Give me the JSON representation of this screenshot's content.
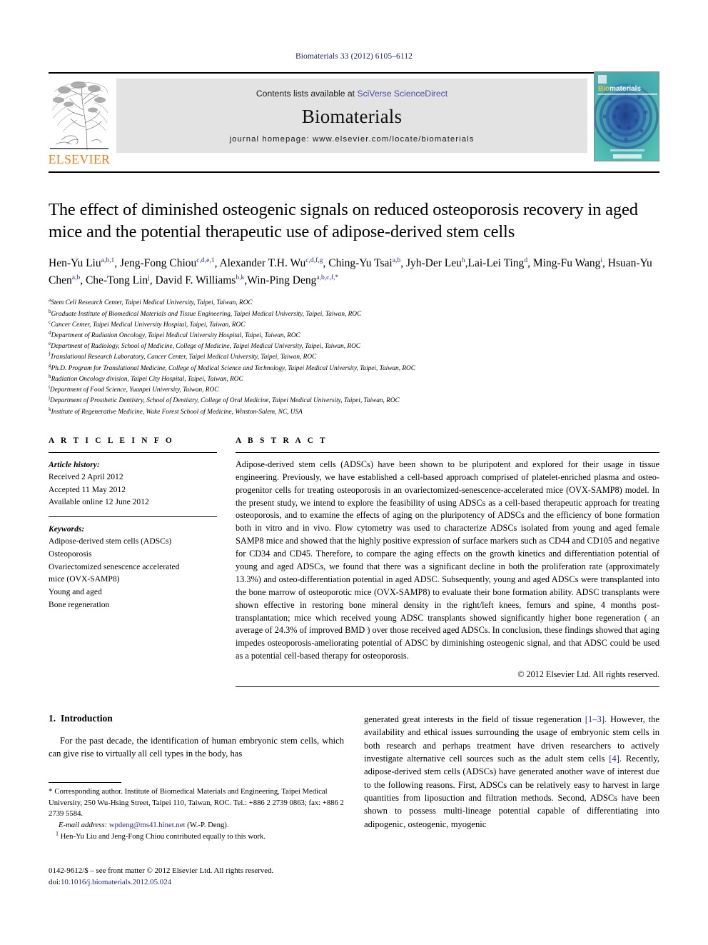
{
  "running_head": "Biomaterials 33 (2012) 6105–6112",
  "masthead": {
    "publisher_name": "ELSEVIER",
    "contents_prefix": "Contents lists available at ",
    "contents_link": "SciVerse ScienceDirect",
    "journal_name": "Biomaterials",
    "homepage_label": "journal homepage: www.elsevier.com/locate/biomaterials",
    "cover_title_pre": "Bio",
    "cover_title_post": "materials"
  },
  "article": {
    "title": "The effect of diminished osteogenic signals on reduced osteoporosis recovery in aged mice and the potential therapeutic use of adipose-derived stem cells",
    "authors": [
      {
        "name": "Hen-Yu Liu",
        "sup": "a,b,1",
        "sep": ", "
      },
      {
        "name": "Jeng-Fong Chiou",
        "sup": "c,d,e,1",
        "sep": ", "
      },
      {
        "name": "Alexander T.H. Wu",
        "sup": "c,d,f,g",
        "sep": ", "
      },
      {
        "name": "Ching-Yu Tsai",
        "sup": "a,b",
        "sep": ", "
      },
      {
        "name": "Jyh-Der Leu",
        "sup": "h",
        "sep": ","
      },
      {
        "name": "Lai-Lei Ting",
        "sup": "d",
        "sep": ", "
      },
      {
        "name": "Ming-Fu Wang",
        "sup": "i",
        "sep": ", "
      },
      {
        "name": "Hsuan-Yu Chen",
        "sup": "a,b",
        "sep": ", "
      },
      {
        "name": "Che-Tong Lin",
        "sup": "j",
        "sep": ", "
      },
      {
        "name": "David F. Williams",
        "sup": "b,k",
        "sep": ","
      },
      {
        "name": "Win-Ping Deng",
        "sup": "a,b,c,f,*",
        "sep": ""
      }
    ],
    "affiliations": [
      {
        "mark": "a",
        "text": "Stem Cell Research Center, Taipei Medical University, Taipei, Taiwan, ROC"
      },
      {
        "mark": "b",
        "text": "Graduate Institute of Biomedical Materials and Tissue Engineering, Taipei Medical University, Taipei, Taiwan, ROC"
      },
      {
        "mark": "c",
        "text": "Cancer Center, Taipei Medical University Hospital, Taipei, Taiwan, ROC"
      },
      {
        "mark": "d",
        "text": "Department of Radiation Oncology, Taipei Medical University Hospital, Taipei, Taiwan, ROC"
      },
      {
        "mark": "e",
        "text": "Department of Radiology, School of Medicine, College of Medicine, Taipei Medical University, Taipei, Taiwan, ROC"
      },
      {
        "mark": "f",
        "text": "Translational Research Laboratory, Cancer Center, Taipei Medical University, Taipei, Taiwan, ROC"
      },
      {
        "mark": "g",
        "text": "Ph.D. Program for Translational Medicine, College of Medical Science and Technology, Taipei Medical University, Taipei, Taiwan, ROC"
      },
      {
        "mark": "h",
        "text": "Radiation Oncology division, Taipei City Hospital, Taipei, Taiwan, ROC"
      },
      {
        "mark": "i",
        "text": "Department of Food Science, Yuanpei University, Taiwan, ROC"
      },
      {
        "mark": "j",
        "text": "Department of Prosthetic Dentistry, School of Dentistry, College of Oral Medicine, Taipei Medical University, Taipei, Taiwan, ROC"
      },
      {
        "mark": "k",
        "text": "Institute of Regenerative Medicine, Wake Forest School of Medicine, Winston-Salem, NC, USA"
      }
    ]
  },
  "article_info": {
    "heading": "A R T I C L E   I N F O",
    "history_label": "Article history:",
    "history": [
      "Received 2 April 2012",
      "Accepted 11 May 2012",
      "Available online 12 June 2012"
    ],
    "keywords_label": "Keywords:",
    "keywords": [
      "Adipose-derived stem cells (ADSCs)",
      "Osteoporosis",
      "Ovariectomized senescence accelerated",
      "mice (OVX-SAMP8)",
      "Young and aged",
      "Bone regeneration"
    ]
  },
  "abstract": {
    "heading": "A B S T R A C T",
    "text": "Adipose-derived stem cells (ADSCs) have been shown to be pluripotent and explored for their usage in tissue engineering. Previously, we have established a cell-based approach comprised of platelet-enriched plasma and osteo-progenitor cells for treating osteoporosis in an ovariectomized-senescence-accelerated mice (OVX-SAMP8) model. In the present study, we intend to explore the feasibility of using ADSCs as a cell-based therapeutic approach for treating osteoporosis, and to examine the effects of aging on the pluripotency of ADSCs and the efficiency of bone formation both in vitro and in vivo. Flow cytometry was used to characterize ADSCs isolated from young and aged female SAMP8 mice and showed that the highly positive expression of surface markers such as CD44 and CD105 and negative for CD34 and CD45. Therefore, to compare the aging effects on the growth kinetics and differentiation potential of young and aged ADSCs, we found that there was a significant decline in both the proliferation rate (approximately 13.3%) and osteo-differentiation potential in aged ADSC. Subsequently, young and aged ADSCs were transplanted into the bone marrow of osteoporotic mice (OVX-SAMP8) to evaluate their bone formation ability. ADSC transplants were shown effective in restoring bone mineral density in the right/left knees, femurs and spine, 4 months post-transplantation; mice which received young ADSC transplants showed significantly higher bone regeneration ( an average of 24.3% of improved BMD )  over those received aged ADSCs. In conclusion, these findings showed that aging impedes osteoporosis-ameliorating potential of ADSC by diminishing osteogenic signal, and that ADSC could be used as a potential cell-based therapy for osteoporosis.",
    "copyright": "© 2012 Elsevier Ltd. All rights reserved."
  },
  "introduction": {
    "number": "1.",
    "title": "Introduction",
    "left_paragraph": "For the past decade, the identification of human embryonic stem cells, which can give rise to virtually all cell types in the body, has",
    "right_paragraph_parts": [
      {
        "t": "generated great interests in the field of tissue regeneration ",
        "ref": false
      },
      {
        "t": "[1–3]",
        "ref": true
      },
      {
        "t": ". However, the availability and ethical issues surrounding the usage of embryonic stem cells in both research and perhaps treatment have driven researchers to actively investigate alternative cell sources such as the adult stem cells ",
        "ref": false
      },
      {
        "t": "[4]",
        "ref": true
      },
      {
        "t": ". Recently, adipose-derived stem cells (ADSCs) have generated another wave of interest due to the following reasons. First, ADSCs can be relatively easy to harvest in large quantities from liposuction and filtration methods. Second, ADSCs have been shown to possess multi-lineage potential capable of differentiating into adipogenic, osteogenic, myogenic",
        "ref": false
      }
    ]
  },
  "footnotes": {
    "corresponding": "Corresponding author. Institute of Biomedical Materials and Engineering, Taipei Medical University, 250 Wu-Hsing Street, Taipei 110, Taiwan, ROC. Tel.: +886 2 2739 0863; fax: +886 2 2739 5584.",
    "email_label": "E-mail address:",
    "email": "wpdeng@ms41.hinet.net",
    "email_suffix": "(W.-P. Deng).",
    "equal_contrib_mark": "1",
    "equal_contrib": "Hen-Yu Liu and Jeng-Fong Chiou contributed equally to this work."
  },
  "footer": {
    "issn_line": "0142-9612/$ – see front matter © 2012 Elsevier Ltd. All rights reserved.",
    "doi_label": "doi:",
    "doi": "10.1016/j.biomaterials.2012.05.024"
  },
  "colors": {
    "running_head": "#1d1d6b",
    "link_blue": "#4b4ba8",
    "elsevier_orange": "#ef7d1a",
    "sup_blue": "#26268f",
    "band_gray": "#e3e3e3",
    "cover_teal": "#41b0ae"
  }
}
